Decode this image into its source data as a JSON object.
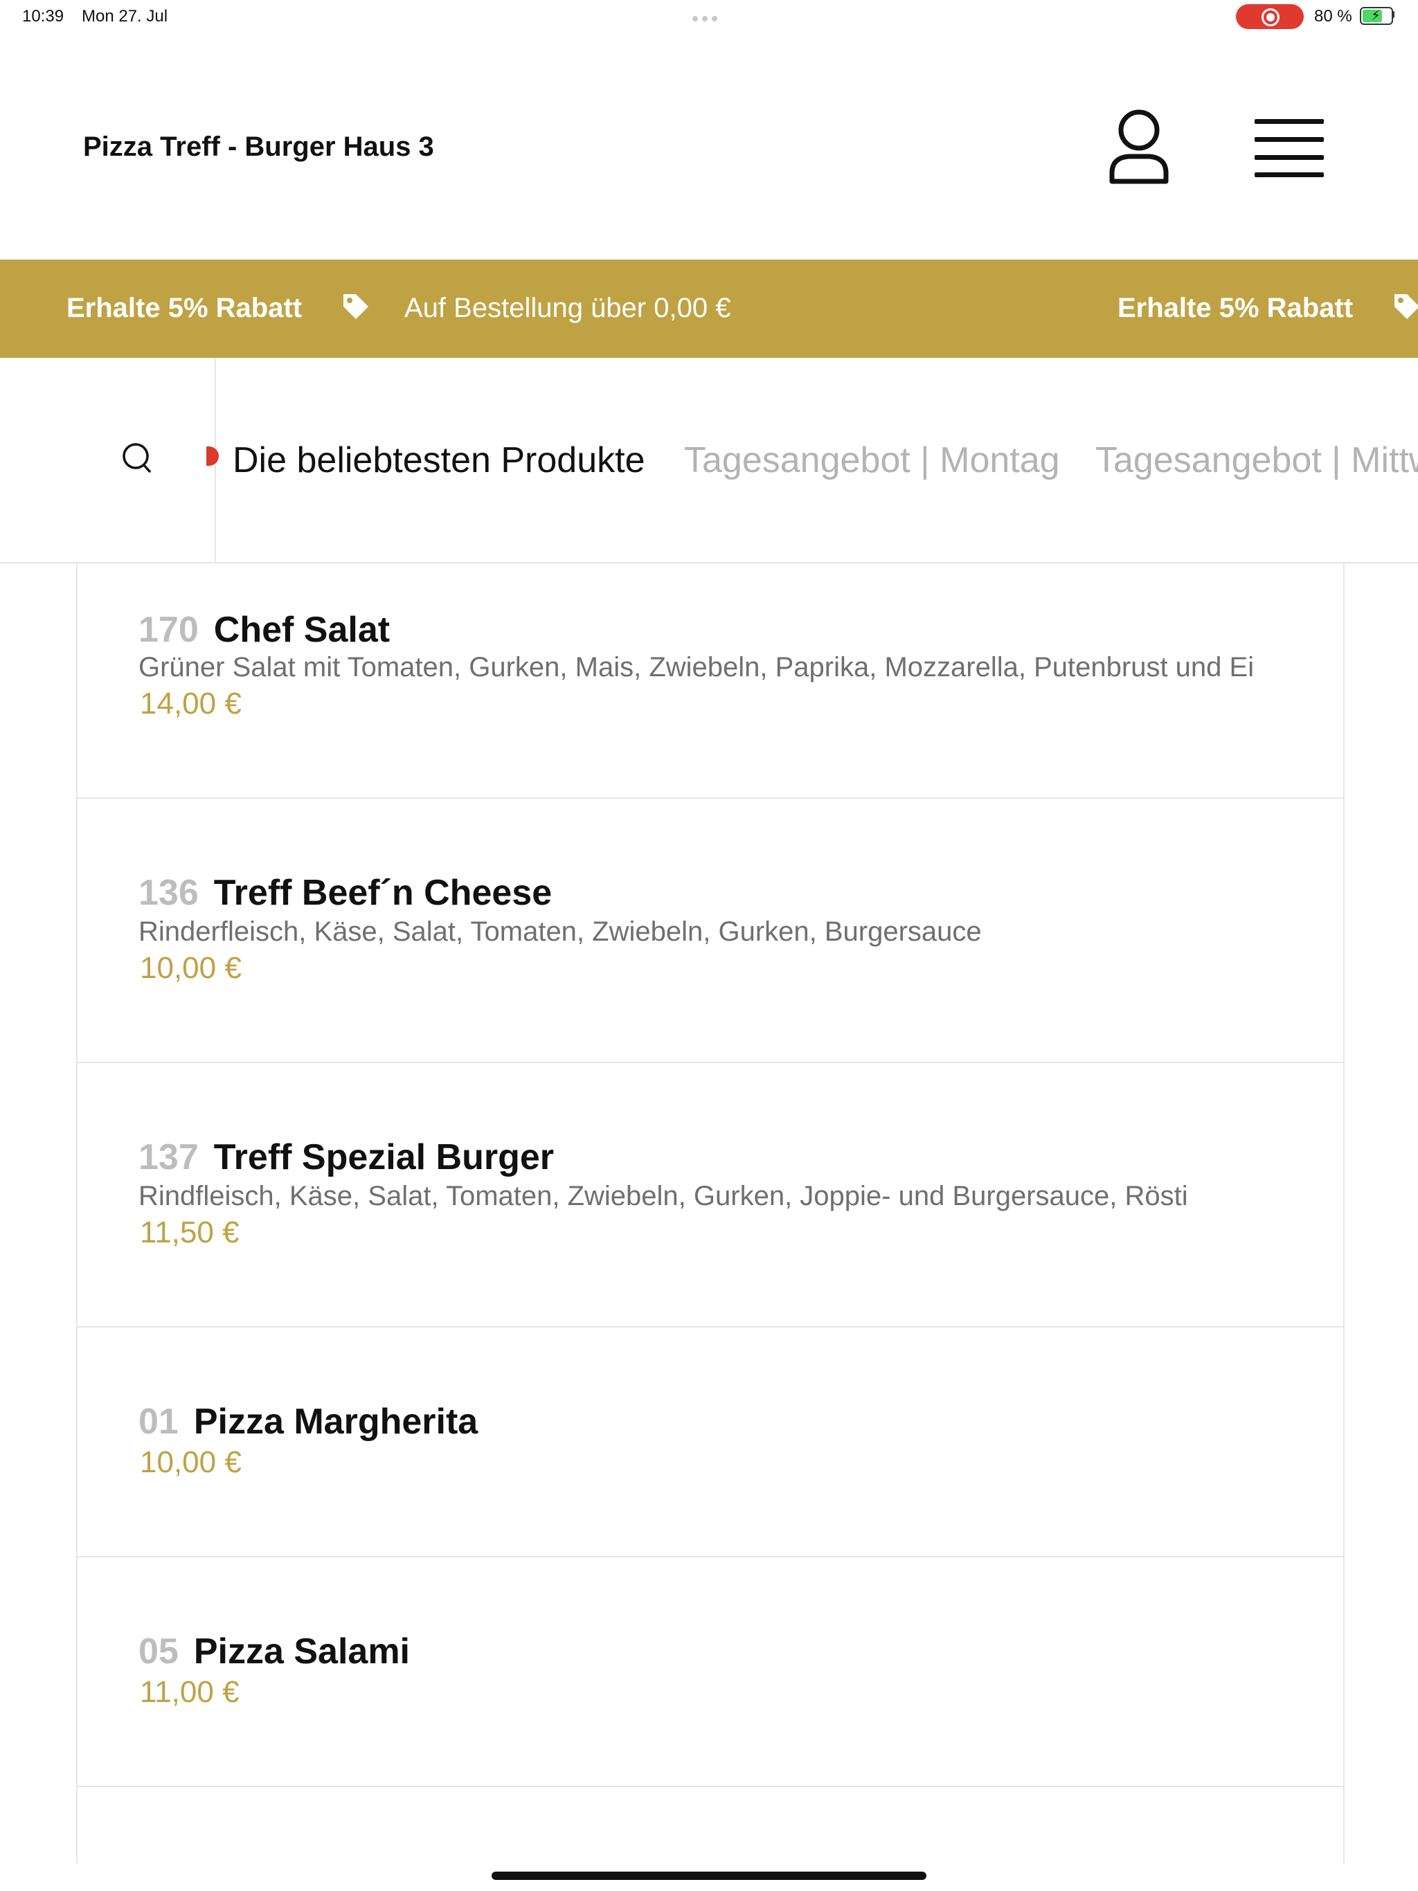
{
  "status_bar": {
    "time": "10:39",
    "date": "Mon 27. Jul",
    "battery": "80 %"
  },
  "header": {
    "store_name": "Pizza Treff - Burger Haus 3",
    "icons": [
      "user-icon",
      "menu-icon"
    ]
  },
  "promo": {
    "discount_label": "Erhalte 5% Rabatt",
    "condition_label": "Auf Bestellung über 0,00 €",
    "icon": "tag-icon",
    "color": "#bfa244"
  },
  "categories": {
    "search_icon": "search-icon",
    "items": [
      {
        "label": "Die beliebtesten Produkte",
        "active": true
      },
      {
        "label": "Tagesangebot | Montag",
        "active": false
      },
      {
        "label": "Tagesangebot | Mittw",
        "active": false
      }
    ]
  },
  "products": [
    {
      "number": "170",
      "name": "Chef Salat",
      "description": "Grüner Salat mit Tomaten, Gurken, Mais, Zwiebeln, Paprika, Mozzarella, Putenbrust und Ei",
      "price": "14,00 €"
    },
    {
      "number": "136",
      "name": "Treff Beef´n Cheese",
      "description": "Rinderfleisch, Käse, Salat, Tomaten, Zwiebeln, Gurken, Burgersauce",
      "price": "10,00 €"
    },
    {
      "number": "137",
      "name": "Treff  Spezial Burger",
      "description": "Rindfleisch, Käse, Salat, Tomaten, Zwiebeln, Gurken, Joppie- und Burgersauce, Rösti",
      "price": "11,50 €"
    },
    {
      "number": "01",
      "name": "Pizza  Margherita",
      "description": "",
      "price": "10,00 €"
    },
    {
      "number": "05",
      "name": "Pizza Salami",
      "description": "",
      "price": "11,00 €"
    }
  ],
  "colors": {
    "accent": "#bfa244",
    "text": "#111111",
    "muted": "#6f6f6f",
    "inactive_tab": "#b3b3b3",
    "record": "#e03a30"
  }
}
